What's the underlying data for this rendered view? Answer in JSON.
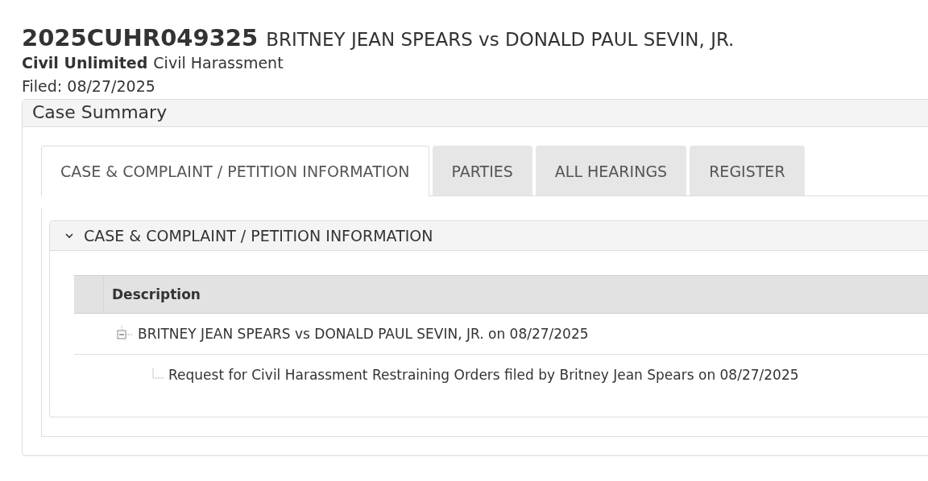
{
  "case": {
    "number": "2025CUHR049325",
    "title": "BRITNEY JEAN SPEARS vs DONALD PAUL SEVIN, JR.",
    "category": "Civil Unlimited",
    "type": "Civil Harassment",
    "filed": "Filed: 08/27/2025"
  },
  "panel": {
    "title": "Case Summary"
  },
  "tabs": [
    {
      "label": "CASE & COMPLAINT / PETITION INFORMATION",
      "selected": true
    },
    {
      "label": "PARTIES",
      "selected": false
    },
    {
      "label": "ALL HEARINGS",
      "selected": false
    },
    {
      "label": "REGISTER",
      "selected": false
    }
  ],
  "section": {
    "title": "CASE & COMPLAINT / PETITION INFORMATION",
    "expanded": true
  },
  "table": {
    "columns": [
      "Description"
    ],
    "tree": [
      {
        "text": "BRITNEY JEAN SPEARS vs DONALD PAUL SEVIN, JR. on 08/27/2025",
        "expanded": true,
        "children": [
          {
            "text": "Request for Civil Harassment Restraining Orders filed by Britney Jean Spears on 08/27/2025"
          }
        ]
      }
    ]
  }
}
